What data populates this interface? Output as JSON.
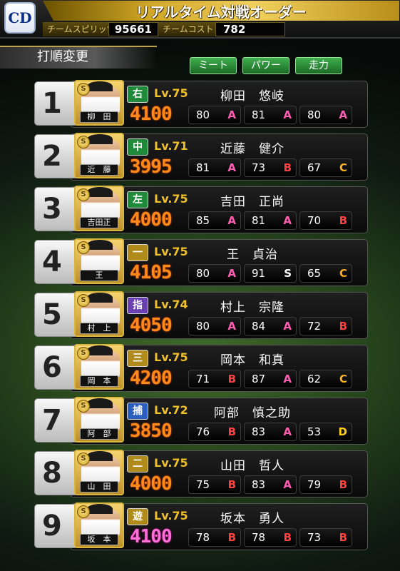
{
  "header": {
    "logo": "CD",
    "title": "リアルタイム対戦オーダー",
    "spirits_label": "チームスピリッツ",
    "spirits": "95661",
    "cost_label": "チームコスト",
    "cost": "782"
  },
  "section": "打順変更",
  "tabs": [
    "ミート",
    "パワー",
    "走力"
  ],
  "players": [
    {
      "order": "1",
      "card": "柳　田",
      "pos": "右",
      "pos_color": "#1f8a3a",
      "lv": "Lv.75",
      "name": "柳田　悠岐",
      "rating": "4100",
      "rating_color": "orange",
      "stats": [
        {
          "n": "80",
          "g": "A"
        },
        {
          "n": "81",
          "g": "A"
        },
        {
          "n": "80",
          "g": "A"
        }
      ]
    },
    {
      "order": "2",
      "card": "近　藤",
      "pos": "中",
      "pos_color": "#1f8a3a",
      "lv": "Lv.71",
      "name": "近藤　健介",
      "rating": "3995",
      "rating_color": "orange",
      "stats": [
        {
          "n": "81",
          "g": "A"
        },
        {
          "n": "73",
          "g": "B"
        },
        {
          "n": "67",
          "g": "C"
        }
      ]
    },
    {
      "order": "3",
      "card": "吉田正",
      "pos": "左",
      "pos_color": "#1f8a3a",
      "lv": "Lv.75",
      "name": "吉田　正尚",
      "rating": "4000",
      "rating_color": "orange",
      "stats": [
        {
          "n": "85",
          "g": "A"
        },
        {
          "n": "81",
          "g": "A"
        },
        {
          "n": "70",
          "g": "B"
        }
      ]
    },
    {
      "order": "4",
      "card": "王",
      "pos": "一",
      "pos_color": "#b08a1a",
      "lv": "Lv.75",
      "name": "王　貞治",
      "rating": "4105",
      "rating_color": "orange",
      "stats": [
        {
          "n": "80",
          "g": "A"
        },
        {
          "n": "91",
          "g": "S"
        },
        {
          "n": "65",
          "g": "C"
        }
      ]
    },
    {
      "order": "5",
      "card": "村　上",
      "pos": "指",
      "pos_color": "#6a3fb0",
      "lv": "Lv.74",
      "name": "村上　宗隆",
      "rating": "4050",
      "rating_color": "orange",
      "stats": [
        {
          "n": "80",
          "g": "A"
        },
        {
          "n": "84",
          "g": "A"
        },
        {
          "n": "72",
          "g": "B"
        }
      ]
    },
    {
      "order": "6",
      "card": "岡　本",
      "pos": "三",
      "pos_color": "#b08a1a",
      "lv": "Lv.75",
      "name": "岡本　和真",
      "rating": "4200",
      "rating_color": "orange",
      "stats": [
        {
          "n": "71",
          "g": "B"
        },
        {
          "n": "87",
          "g": "A"
        },
        {
          "n": "62",
          "g": "C"
        }
      ]
    },
    {
      "order": "7",
      "card": "阿　部",
      "pos": "捕",
      "pos_color": "#2a5fc0",
      "lv": "Lv.72",
      "name": "阿部　慎之助",
      "rating": "3850",
      "rating_color": "orange",
      "stats": [
        {
          "n": "76",
          "g": "B"
        },
        {
          "n": "83",
          "g": "A"
        },
        {
          "n": "53",
          "g": "D"
        }
      ]
    },
    {
      "order": "8",
      "card": "山　田",
      "pos": "二",
      "pos_color": "#b08a1a",
      "lv": "Lv.75",
      "name": "山田　哲人",
      "rating": "4000",
      "rating_color": "orange",
      "stats": [
        {
          "n": "75",
          "g": "B"
        },
        {
          "n": "83",
          "g": "A"
        },
        {
          "n": "79",
          "g": "B"
        }
      ]
    },
    {
      "order": "9",
      "card": "坂　本",
      "pos": "遊",
      "pos_color": "#b08a1a",
      "lv": "Lv.75",
      "name": "坂本　勇人",
      "rating": "4100",
      "rating_color": "pink",
      "stats": [
        {
          "n": "78",
          "g": "B"
        },
        {
          "n": "78",
          "g": "B"
        },
        {
          "n": "73",
          "g": "B"
        }
      ]
    }
  ]
}
